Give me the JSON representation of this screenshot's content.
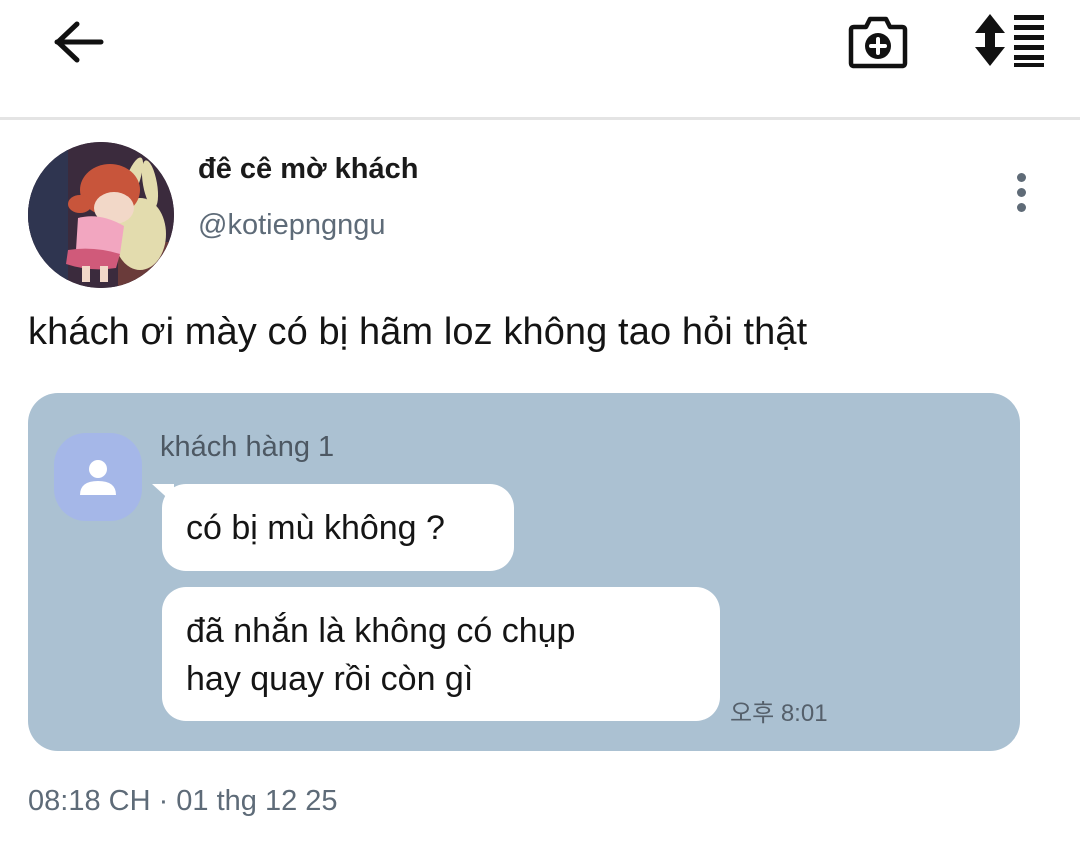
{
  "header": {
    "back_icon": "arrow-left-icon",
    "camera_icon": "camera-plus-icon",
    "sort_icon": "sort-list-icon"
  },
  "post": {
    "display_name": "đê cê mờ khách",
    "handle": "@kotiepngngu",
    "text": "khách ơi mày có bị hãm loz không tao hỏi thật",
    "timestamp": "08:18 CH · 01 thg 12 25",
    "more_icon": "more-vertical-icon"
  },
  "chat": {
    "background": "#abc1d2",
    "sender": "khách hàng 1",
    "messages": [
      {
        "text": "có bị mù không ?"
      },
      {
        "line1": "đã nhắn là không có chụp",
        "line2": "hay quay rồi còn gì"
      }
    ],
    "time": "오후 8:01"
  }
}
